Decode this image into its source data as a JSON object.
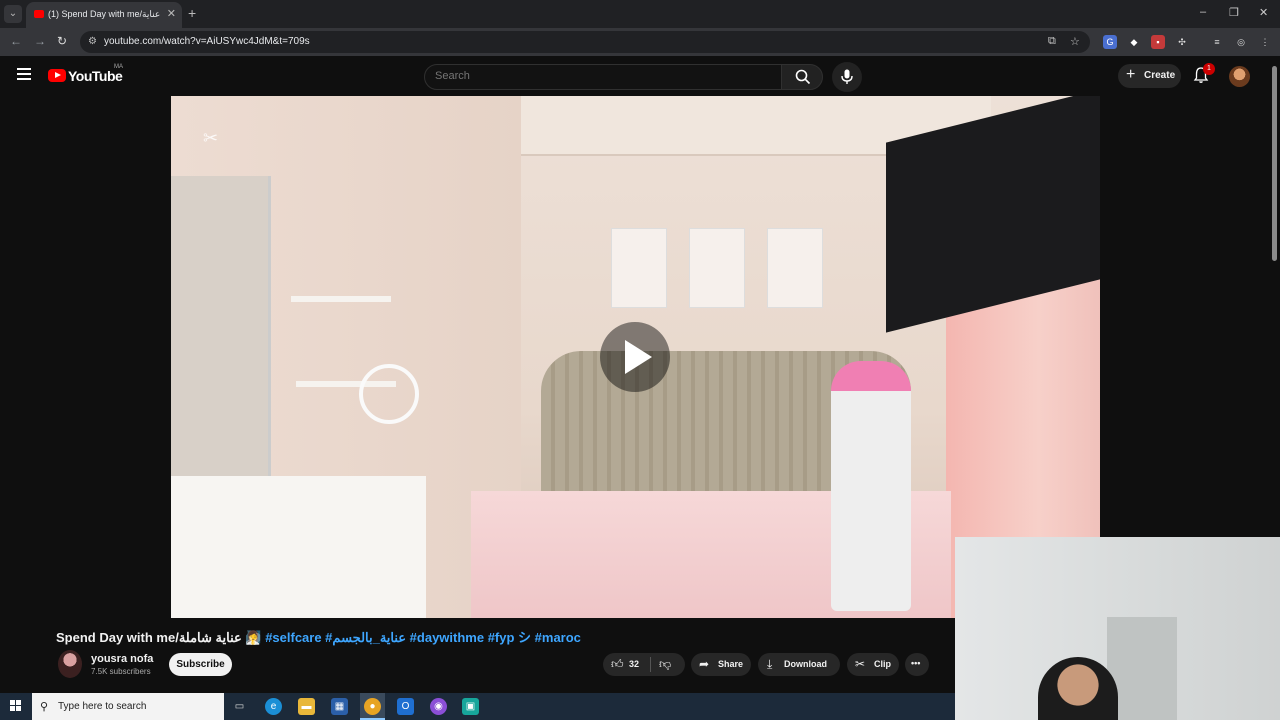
{
  "browser": {
    "tab_title": "(1) Spend Day with me/عناية",
    "url": "youtube.com/watch?v=AiUSYwc4JdM&t=709s",
    "new_tab": "+",
    "window_controls": [
      "–",
      "❐",
      "✕"
    ]
  },
  "youtube": {
    "logo_text": "YouTube",
    "region": "MA",
    "search_placeholder": "Search",
    "create_label": "Create",
    "notification_count": "1"
  },
  "video": {
    "title_main": "Spend Day with me/عناية شاملة 🧖‍♀️",
    "hashtags": "#selfcare #عناية_بالجسم #daywithme #fyp シ #maroc",
    "channel_name": "yousra nofa",
    "subscribers": "7.5K subscribers",
    "subscribe_label": "Subscribe",
    "like_count": "32",
    "share_label": "Share",
    "download_label": "Download",
    "clip_label": "Clip",
    "more_label": "•••"
  },
  "taskbar": {
    "search_placeholder": "Type here to search",
    "apps": [
      "task-view",
      "edge",
      "file-explorer",
      "store",
      "chrome",
      "outlook",
      "messenger",
      "app"
    ]
  },
  "colors": {
    "yt_red": "#ff0000",
    "link_blue": "#3ea6ff",
    "background": "#0f0f0f"
  }
}
